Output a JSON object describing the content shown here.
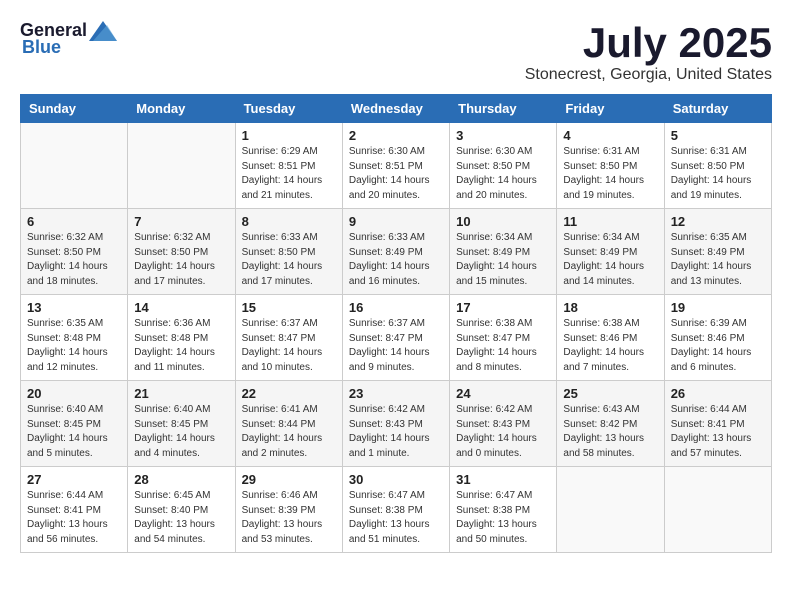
{
  "logo": {
    "general": "General",
    "blue": "Blue"
  },
  "title": {
    "month_year": "July 2025",
    "location": "Stonecrest, Georgia, United States"
  },
  "headers": [
    "Sunday",
    "Monday",
    "Tuesday",
    "Wednesday",
    "Thursday",
    "Friday",
    "Saturday"
  ],
  "weeks": [
    [
      {
        "day": "",
        "sunrise": "",
        "sunset": "",
        "daylight": ""
      },
      {
        "day": "",
        "sunrise": "",
        "sunset": "",
        "daylight": ""
      },
      {
        "day": "1",
        "sunrise": "Sunrise: 6:29 AM",
        "sunset": "Sunset: 8:51 PM",
        "daylight": "Daylight: 14 hours and 21 minutes."
      },
      {
        "day": "2",
        "sunrise": "Sunrise: 6:30 AM",
        "sunset": "Sunset: 8:51 PM",
        "daylight": "Daylight: 14 hours and 20 minutes."
      },
      {
        "day": "3",
        "sunrise": "Sunrise: 6:30 AM",
        "sunset": "Sunset: 8:50 PM",
        "daylight": "Daylight: 14 hours and 20 minutes."
      },
      {
        "day": "4",
        "sunrise": "Sunrise: 6:31 AM",
        "sunset": "Sunset: 8:50 PM",
        "daylight": "Daylight: 14 hours and 19 minutes."
      },
      {
        "day": "5",
        "sunrise": "Sunrise: 6:31 AM",
        "sunset": "Sunset: 8:50 PM",
        "daylight": "Daylight: 14 hours and 19 minutes."
      }
    ],
    [
      {
        "day": "6",
        "sunrise": "Sunrise: 6:32 AM",
        "sunset": "Sunset: 8:50 PM",
        "daylight": "Daylight: 14 hours and 18 minutes."
      },
      {
        "day": "7",
        "sunrise": "Sunrise: 6:32 AM",
        "sunset": "Sunset: 8:50 PM",
        "daylight": "Daylight: 14 hours and 17 minutes."
      },
      {
        "day": "8",
        "sunrise": "Sunrise: 6:33 AM",
        "sunset": "Sunset: 8:50 PM",
        "daylight": "Daylight: 14 hours and 17 minutes."
      },
      {
        "day": "9",
        "sunrise": "Sunrise: 6:33 AM",
        "sunset": "Sunset: 8:49 PM",
        "daylight": "Daylight: 14 hours and 16 minutes."
      },
      {
        "day": "10",
        "sunrise": "Sunrise: 6:34 AM",
        "sunset": "Sunset: 8:49 PM",
        "daylight": "Daylight: 14 hours and 15 minutes."
      },
      {
        "day": "11",
        "sunrise": "Sunrise: 6:34 AM",
        "sunset": "Sunset: 8:49 PM",
        "daylight": "Daylight: 14 hours and 14 minutes."
      },
      {
        "day": "12",
        "sunrise": "Sunrise: 6:35 AM",
        "sunset": "Sunset: 8:49 PM",
        "daylight": "Daylight: 14 hours and 13 minutes."
      }
    ],
    [
      {
        "day": "13",
        "sunrise": "Sunrise: 6:35 AM",
        "sunset": "Sunset: 8:48 PM",
        "daylight": "Daylight: 14 hours and 12 minutes."
      },
      {
        "day": "14",
        "sunrise": "Sunrise: 6:36 AM",
        "sunset": "Sunset: 8:48 PM",
        "daylight": "Daylight: 14 hours and 11 minutes."
      },
      {
        "day": "15",
        "sunrise": "Sunrise: 6:37 AM",
        "sunset": "Sunset: 8:47 PM",
        "daylight": "Daylight: 14 hours and 10 minutes."
      },
      {
        "day": "16",
        "sunrise": "Sunrise: 6:37 AM",
        "sunset": "Sunset: 8:47 PM",
        "daylight": "Daylight: 14 hours and 9 minutes."
      },
      {
        "day": "17",
        "sunrise": "Sunrise: 6:38 AM",
        "sunset": "Sunset: 8:47 PM",
        "daylight": "Daylight: 14 hours and 8 minutes."
      },
      {
        "day": "18",
        "sunrise": "Sunrise: 6:38 AM",
        "sunset": "Sunset: 8:46 PM",
        "daylight": "Daylight: 14 hours and 7 minutes."
      },
      {
        "day": "19",
        "sunrise": "Sunrise: 6:39 AM",
        "sunset": "Sunset: 8:46 PM",
        "daylight": "Daylight: 14 hours and 6 minutes."
      }
    ],
    [
      {
        "day": "20",
        "sunrise": "Sunrise: 6:40 AM",
        "sunset": "Sunset: 8:45 PM",
        "daylight": "Daylight: 14 hours and 5 minutes."
      },
      {
        "day": "21",
        "sunrise": "Sunrise: 6:40 AM",
        "sunset": "Sunset: 8:45 PM",
        "daylight": "Daylight: 14 hours and 4 minutes."
      },
      {
        "day": "22",
        "sunrise": "Sunrise: 6:41 AM",
        "sunset": "Sunset: 8:44 PM",
        "daylight": "Daylight: 14 hours and 2 minutes."
      },
      {
        "day": "23",
        "sunrise": "Sunrise: 6:42 AM",
        "sunset": "Sunset: 8:43 PM",
        "daylight": "Daylight: 14 hours and 1 minute."
      },
      {
        "day": "24",
        "sunrise": "Sunrise: 6:42 AM",
        "sunset": "Sunset: 8:43 PM",
        "daylight": "Daylight: 14 hours and 0 minutes."
      },
      {
        "day": "25",
        "sunrise": "Sunrise: 6:43 AM",
        "sunset": "Sunset: 8:42 PM",
        "daylight": "Daylight: 13 hours and 58 minutes."
      },
      {
        "day": "26",
        "sunrise": "Sunrise: 6:44 AM",
        "sunset": "Sunset: 8:41 PM",
        "daylight": "Daylight: 13 hours and 57 minutes."
      }
    ],
    [
      {
        "day": "27",
        "sunrise": "Sunrise: 6:44 AM",
        "sunset": "Sunset: 8:41 PM",
        "daylight": "Daylight: 13 hours and 56 minutes."
      },
      {
        "day": "28",
        "sunrise": "Sunrise: 6:45 AM",
        "sunset": "Sunset: 8:40 PM",
        "daylight": "Daylight: 13 hours and 54 minutes."
      },
      {
        "day": "29",
        "sunrise": "Sunrise: 6:46 AM",
        "sunset": "Sunset: 8:39 PM",
        "daylight": "Daylight: 13 hours and 53 minutes."
      },
      {
        "day": "30",
        "sunrise": "Sunrise: 6:47 AM",
        "sunset": "Sunset: 8:38 PM",
        "daylight": "Daylight: 13 hours and 51 minutes."
      },
      {
        "day": "31",
        "sunrise": "Sunrise: 6:47 AM",
        "sunset": "Sunset: 8:38 PM",
        "daylight": "Daylight: 13 hours and 50 minutes."
      },
      {
        "day": "",
        "sunrise": "",
        "sunset": "",
        "daylight": ""
      },
      {
        "day": "",
        "sunrise": "",
        "sunset": "",
        "daylight": ""
      }
    ]
  ]
}
